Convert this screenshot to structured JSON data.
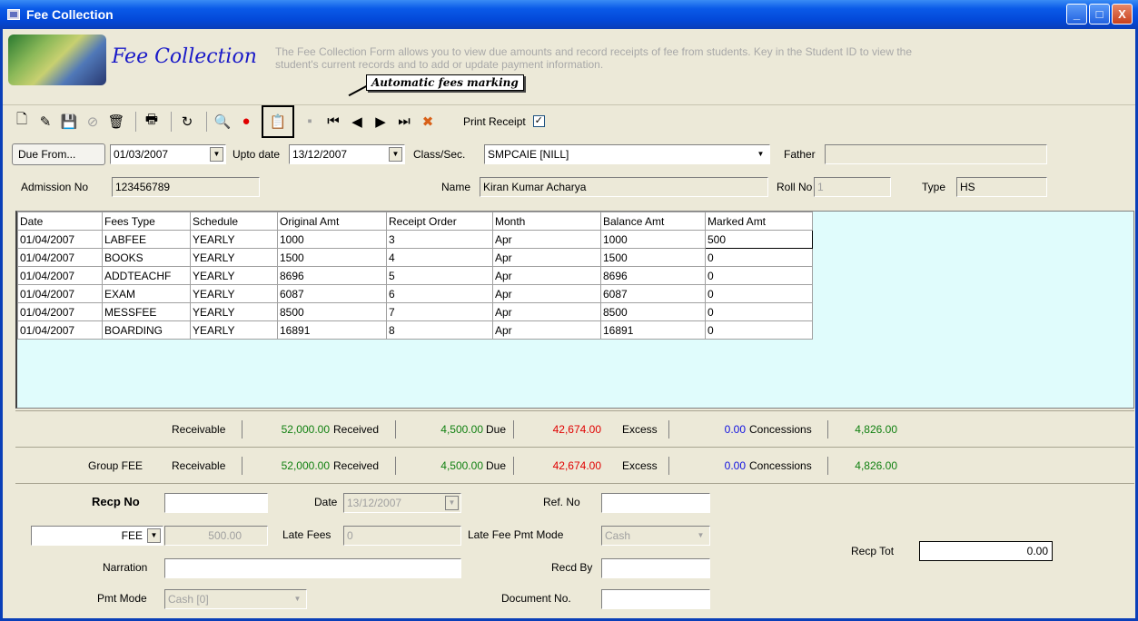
{
  "window": {
    "title": "Fee Collection",
    "buttons": [
      "_",
      "□",
      "X"
    ]
  },
  "header": {
    "title": "Fee Collection",
    "description": "The Fee Collection Form allows you to view due amounts and record receipts of fee from students. Key in the Student ID to view the student's current records and to add or update payment information.",
    "callout": "Automatic fees marking"
  },
  "toolbar": {
    "print_receipt_label": "Print Receipt",
    "print_receipt_checked": true,
    "check_mark": "✓",
    "icons": {
      "new": "🗋",
      "edit": "✎",
      "save": "💾",
      "cancel": "⊘",
      "delete": "🗑",
      "print": "🖶",
      "refresh": "↻",
      "find": "🔍",
      "stop": "●",
      "auto": "📋",
      "blank": "▪",
      "first": "⏮",
      "prev": "◀",
      "next": "▶",
      "last": "⏭",
      "exit": "✖"
    }
  },
  "filters": {
    "due_from_label": "Due From...",
    "due_from_value": "01/03/2007",
    "upto_label": "Upto date",
    "upto_value": "13/12/2007",
    "class_label": "Class/Sec.",
    "class_value": "SMPCAIE [NILL]",
    "father_label": "Father",
    "father_value": "",
    "admission_label": "Admission No",
    "admission_value": "123456789",
    "name_label": "Name",
    "name_value": "Kiran Kumar Acharya",
    "roll_label": "Roll No",
    "roll_value": "1",
    "type_label": "Type",
    "type_value": "HS"
  },
  "grid": {
    "columns": [
      "Date",
      "Fees Type",
      "Schedule",
      "Original Amt",
      "Receipt Order",
      "Month",
      "Balance Amt",
      "Marked Amt"
    ],
    "rows": [
      [
        "01/04/2007",
        "LABFEE",
        "YEARLY",
        "1000",
        "3",
        "Apr",
        "1000",
        "500"
      ],
      [
        "01/04/2007",
        "BOOKS",
        "YEARLY",
        "1500",
        "4",
        "Apr",
        "1500",
        "0"
      ],
      [
        "01/04/2007",
        "ADDTEACHF",
        "YEARLY",
        "8696",
        "5",
        "Apr",
        "8696",
        "0"
      ],
      [
        "01/04/2007",
        "EXAM",
        "YEARLY",
        "6087",
        "6",
        "Apr",
        "6087",
        "0"
      ],
      [
        "01/04/2007",
        "MESSFEE",
        "YEARLY",
        "8500",
        "7",
        "Apr",
        "8500",
        "0"
      ],
      [
        "01/04/2007",
        "BOARDING",
        "YEARLY",
        "16891",
        "8",
        "Apr",
        "16891",
        "0"
      ]
    ]
  },
  "summary1": {
    "prefix": "",
    "receivable_label": "Receivable",
    "receivable": "52,000.00",
    "received_label": "Received",
    "received": "4,500.00",
    "due_label": "Due",
    "due": "42,674.00",
    "excess_label": "Excess",
    "excess": "0.00",
    "concessions_label": "Concessions",
    "concessions": "4,826.00"
  },
  "summary2": {
    "prefix": "Group FEE",
    "receivable_label": "Receivable",
    "receivable": "52,000.00",
    "received_label": "Received",
    "received": "4,500.00",
    "due_label": "Due",
    "due": "42,674.00",
    "excess_label": "Excess",
    "excess": "0.00",
    "concessions_label": "Concessions",
    "concessions": "4,826.00"
  },
  "receipt": {
    "recp_no_label": "Recp No",
    "recp_no": "",
    "date_label": "Date",
    "date": "13/12/2007",
    "ref_no_label": "Ref. No",
    "ref_no": "",
    "fee_type": "FEE",
    "amount": "500.00",
    "late_fees_label": "Late Fees",
    "late_fees": "0",
    "late_mode_label": "Late Fee Pmt Mode",
    "late_mode": "Cash",
    "recp_tot_label": "Recp Tot",
    "recp_tot": "0.00",
    "narration_label": "Narration",
    "narration": "",
    "recd_by_label": "Recd By",
    "recd_by": "",
    "pmt_mode_label": "Pmt Mode",
    "pmt_mode": "Cash [0]",
    "doc_no_label": "Document No.",
    "doc_no": ""
  },
  "colors": {
    "titlebar": "#0a3fb8",
    "form_bg": "#ece9d8",
    "grid_bg": "#e0fcfc",
    "green": "#108010",
    "red": "#e00000",
    "blue": "#1010e0"
  }
}
